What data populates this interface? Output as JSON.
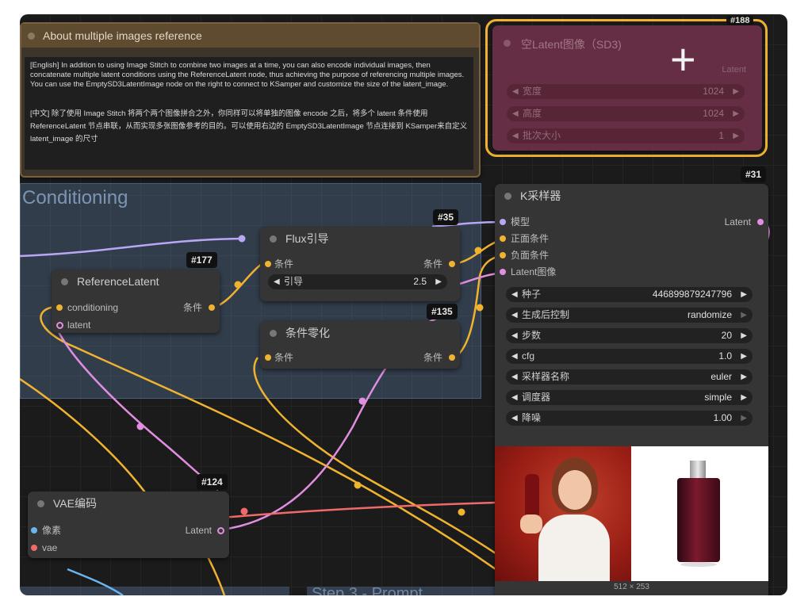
{
  "note": {
    "title": "About multiple images reference",
    "english": "[English] In addition to using Image Stitch to combine two images at a time, you can also encode individual images, then concatenate multiple latent conditions using the ReferenceLatent node, thus achieving the purpose of referencing multiple images. You can use the EmptySD3LatentImage node on the right to connect to KSamper and customize the size of the latent_image.",
    "chinese": "[中文] 除了使用 Image Stitch 将两个两个图像拼合之外，你同样可以将单独的图像 encode 之后，将多个 latent 条件使用 ReferenceLatent 节点串联，从而实现多张图像参考的目的。可以使用右边的 EmptySD3LatentImage 节点连接到 KSamper来自定义 latent_image 的尺寸"
  },
  "group": {
    "title": "Conditioning",
    "bottom_group_title": "Step 3 - Prompt"
  },
  "empty_latent": {
    "badge": "#188",
    "title": "空Latent图像（SD3)",
    "output": "Latent",
    "widgets": [
      {
        "label": "宽度",
        "value": "1024"
      },
      {
        "label": "高度",
        "value": "1024"
      },
      {
        "label": "批次大小",
        "value": "1"
      }
    ],
    "cursor": "+"
  },
  "flux_guidance": {
    "badge": "#35",
    "title": "Flux引导",
    "input": "条件",
    "output": "条件",
    "widget": {
      "label": "引导",
      "value": "2.5"
    }
  },
  "reference_latent": {
    "badge": "#177",
    "title": "ReferenceLatent",
    "inputs": [
      "conditioning",
      "latent"
    ],
    "output": "条件"
  },
  "zero_cond": {
    "badge": "#135",
    "title": "条件零化",
    "input": "条件",
    "output": "条件"
  },
  "ksampler": {
    "badge": "#31",
    "title": "K采样器",
    "inputs": [
      "模型",
      "正面条件",
      "负面条件",
      "Latent图像"
    ],
    "output": "Latent",
    "widgets": [
      {
        "label": "种子",
        "value": "446899879247796"
      },
      {
        "label": "生成后控制",
        "value": "randomize"
      },
      {
        "label": "步数",
        "value": "20"
      },
      {
        "label": "cfg",
        "value": "1.0"
      },
      {
        "label": "采样器名称",
        "value": "euler"
      },
      {
        "label": "调度器",
        "value": "simple"
      },
      {
        "label": "降噪",
        "value": "1.00"
      }
    ],
    "preview_caption": "512 × 253"
  },
  "vae_encode": {
    "badge": "#124",
    "title": "VAE编码",
    "inputs": [
      "像素",
      "vae"
    ],
    "output": "Latent"
  },
  "colors": {
    "conditioning_wire": "#f0b330",
    "latent_wire": "#e08ee0",
    "model_wire": "#b9a6f5",
    "vae_wire": "#f06a6a",
    "image_wire": "#6ab4f0",
    "note_header": "#5e4b30",
    "note_border": "#7a6240",
    "selection": "#f0b030"
  },
  "icons": [
    "left-arrow-icon",
    "right-arrow-icon",
    "crosshair-cursor-icon"
  ]
}
